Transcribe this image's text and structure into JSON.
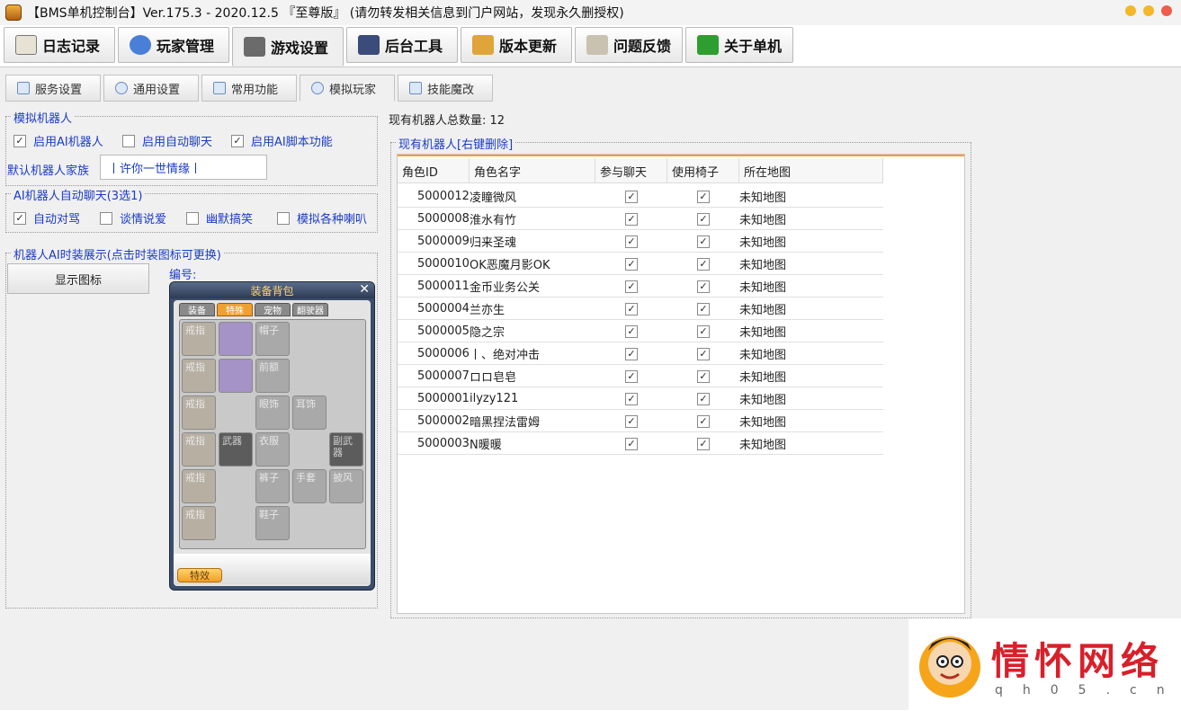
{
  "window": {
    "title": "【BMS单机控制台】Ver.175.3 - 2020.12.5 『至尊版』 (请勿转发相关信息到门户网站，发现永久删授权)",
    "dot_colors": [
      "#f4b728",
      "#f4b728",
      "#f05d4a"
    ]
  },
  "main_tabs": [
    {
      "label": "日志记录",
      "icon": "journal-icon",
      "color": "#e8e2d4"
    },
    {
      "label": "玩家管理",
      "icon": "web-icon",
      "color": "#4a7fd8"
    },
    {
      "label": "游戏设置",
      "icon": "wrench-icon",
      "color": "#6b6b6b"
    },
    {
      "label": "后台工具",
      "icon": "monitor-icon",
      "color": "#3b4b7a"
    },
    {
      "label": "版本更新",
      "icon": "scroll-icon",
      "color": "#e0a53a"
    },
    {
      "label": "问题反馈",
      "icon": "feedback-icon",
      "color": "#c9c2b0"
    },
    {
      "label": "关于单机",
      "icon": "help-icon",
      "color": "#2e9e2e"
    }
  ],
  "sub_tabs": [
    {
      "label": "服务设置",
      "icon": "service-icon"
    },
    {
      "label": "通用设置",
      "icon": "search-icon"
    },
    {
      "label": "常用功能",
      "icon": "hand-icon"
    },
    {
      "label": "模拟玩家",
      "icon": "player-icon"
    },
    {
      "label": "技能魔改",
      "icon": "skill-icon"
    }
  ],
  "robot": {
    "group_title": "模拟机器人",
    "enable_ai": {
      "label": "启用AI机器人",
      "checked": true
    },
    "enable_chat": {
      "label": "启用自动聊天",
      "checked": false
    },
    "enable_script": {
      "label": "启用AI脚本功能",
      "checked": true
    },
    "family_label": "默认机器人家族",
    "family_value": "丨许你一世情缘丨"
  },
  "chat": {
    "group_title": "AI机器人自动聊天(3选1)",
    "options": [
      {
        "label": "自动对骂",
        "checked": true
      },
      {
        "label": "谈情说爱",
        "checked": false
      },
      {
        "label": "幽默搞笑",
        "checked": false
      },
      {
        "label": "模拟各种喇叭",
        "checked": false
      }
    ]
  },
  "fashion": {
    "group_title": "机器人AI时装展示(点击时装图标可更换)",
    "show_button": "显示图标",
    "number_label": "编号:"
  },
  "equipment": {
    "title": "装备背包",
    "tabs": [
      "装备",
      "特殊",
      "宠物",
      "翻驶器"
    ],
    "slots": {
      "ring1": "戒指",
      "ring2": "戒指",
      "ring3": "戒指",
      "ring4": "戒指",
      "ring5": "戒指",
      "ring6": "戒指",
      "hat": "帽子",
      "forehead": "前额",
      "eye": "眼饰",
      "ear": "耳饰",
      "weapon": "武器",
      "top": "衣服",
      "subweapon": "副武器",
      "pants": "裤子",
      "gloves": "手套",
      "cape": "披风",
      "shoes": "鞋子"
    },
    "effect_button": "特效"
  },
  "robots_total": {
    "label": "现有机器人总数量:",
    "value": "12"
  },
  "robots_table": {
    "group_title": "现有机器人[右键删除]",
    "columns": [
      "角色ID",
      "角色名字",
      "参与聊天",
      "使用椅子",
      "所在地图"
    ],
    "rows": [
      {
        "id": "5000012",
        "name": "凌瞳微风",
        "chat": true,
        "chair": true,
        "map": "未知地图"
      },
      {
        "id": "5000008",
        "name": "淮水有竹",
        "chat": true,
        "chair": true,
        "map": "未知地图"
      },
      {
        "id": "5000009",
        "name": "归来圣魂",
        "chat": true,
        "chair": true,
        "map": "未知地图"
      },
      {
        "id": "5000010",
        "name": "OK恶魔月影OK",
        "chat": true,
        "chair": true,
        "map": "未知地图"
      },
      {
        "id": "5000011",
        "name": "金币业务公关",
        "chat": true,
        "chair": true,
        "map": "未知地图"
      },
      {
        "id": "5000004",
        "name": "兰亦生",
        "chat": true,
        "chair": true,
        "map": "未知地图"
      },
      {
        "id": "5000005",
        "name": "隐之宗",
        "chat": true,
        "chair": true,
        "map": "未知地图"
      },
      {
        "id": "5000006",
        "name": "丨、绝对冲击",
        "chat": true,
        "chair": true,
        "map": "未知地图"
      },
      {
        "id": "5000007",
        "name": "ロロ皂皂",
        "chat": true,
        "chair": true,
        "map": "未知地图"
      },
      {
        "id": "5000001",
        "name": "ilyzy121",
        "chat": true,
        "chair": true,
        "map": "未知地图"
      },
      {
        "id": "5000002",
        "name": "暗黑捏法雷姆",
        "chat": true,
        "chair": true,
        "map": "未知地图"
      },
      {
        "id": "5000003",
        "name": "N暖暖",
        "chat": true,
        "chair": true,
        "map": "未知地图"
      }
    ]
  },
  "watermark": {
    "title": "情怀网络",
    "subtitle": "qh05.cn"
  }
}
